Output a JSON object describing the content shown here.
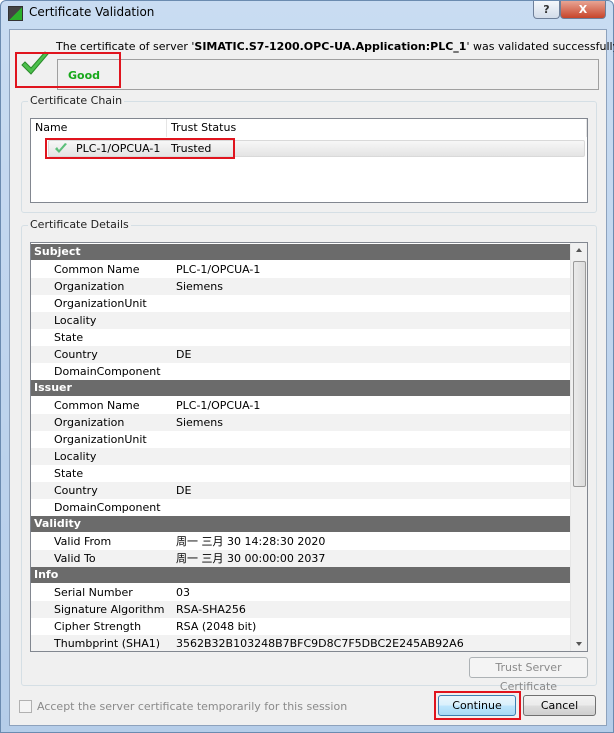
{
  "window": {
    "title": "Certificate Validation",
    "help_label": "?",
    "close_label": "X"
  },
  "message": {
    "prefix": "The certificate of server '",
    "server": "SIMATIC.S7-1200.OPC-UA.Application:PLC_1",
    "suffix": "' was validated successfully."
  },
  "status": {
    "label": "Good",
    "color": "#17a81a"
  },
  "chain": {
    "group_label": "Certificate Chain",
    "columns": [
      "Name",
      "Trust Status"
    ],
    "rows": [
      {
        "name": "PLC-1/OPCUA-1",
        "trust": "Trusted"
      }
    ]
  },
  "details": {
    "group_label": "Certificate Details",
    "sections": [
      {
        "title": "Subject",
        "rows": [
          {
            "k": "Common Name",
            "v": "PLC-1/OPCUA-1"
          },
          {
            "k": "Organization",
            "v": "Siemens"
          },
          {
            "k": "OrganizationUnit",
            "v": ""
          },
          {
            "k": "Locality",
            "v": ""
          },
          {
            "k": "State",
            "v": ""
          },
          {
            "k": "Country",
            "v": "DE"
          },
          {
            "k": "DomainComponent",
            "v": ""
          }
        ]
      },
      {
        "title": "Issuer",
        "rows": [
          {
            "k": "Common Name",
            "v": "PLC-1/OPCUA-1"
          },
          {
            "k": "Organization",
            "v": "Siemens"
          },
          {
            "k": "OrganizationUnit",
            "v": ""
          },
          {
            "k": "Locality",
            "v": ""
          },
          {
            "k": "State",
            "v": ""
          },
          {
            "k": "Country",
            "v": "DE"
          },
          {
            "k": "DomainComponent",
            "v": ""
          }
        ]
      },
      {
        "title": "Validity",
        "rows": [
          {
            "k": "Valid From",
            "v": "周一 三月 30 14:28:30 2020"
          },
          {
            "k": "Valid To",
            "v": "周一 三月 30 00:00:00 2037"
          }
        ]
      },
      {
        "title": "Info",
        "rows": [
          {
            "k": "Serial Number",
            "v": "03"
          },
          {
            "k": "Signature Algorithm",
            "v": "RSA-SHA256"
          },
          {
            "k": "Cipher Strength",
            "v": "RSA (2048 bit)"
          },
          {
            "k": "Thumbprint (SHA1)",
            "v": "3562B32B103248B7BFC9D8C7F5DBC2E245AB92A6"
          }
        ]
      },
      {
        "title": "UA Extension",
        "rows": []
      }
    ],
    "trust_button": "Trust Server Certificate"
  },
  "footer": {
    "accept_label": "Accept the server certificate temporarily for this session",
    "accept_checked": false,
    "continue_label": "Continue",
    "cancel_label": "Cancel"
  }
}
